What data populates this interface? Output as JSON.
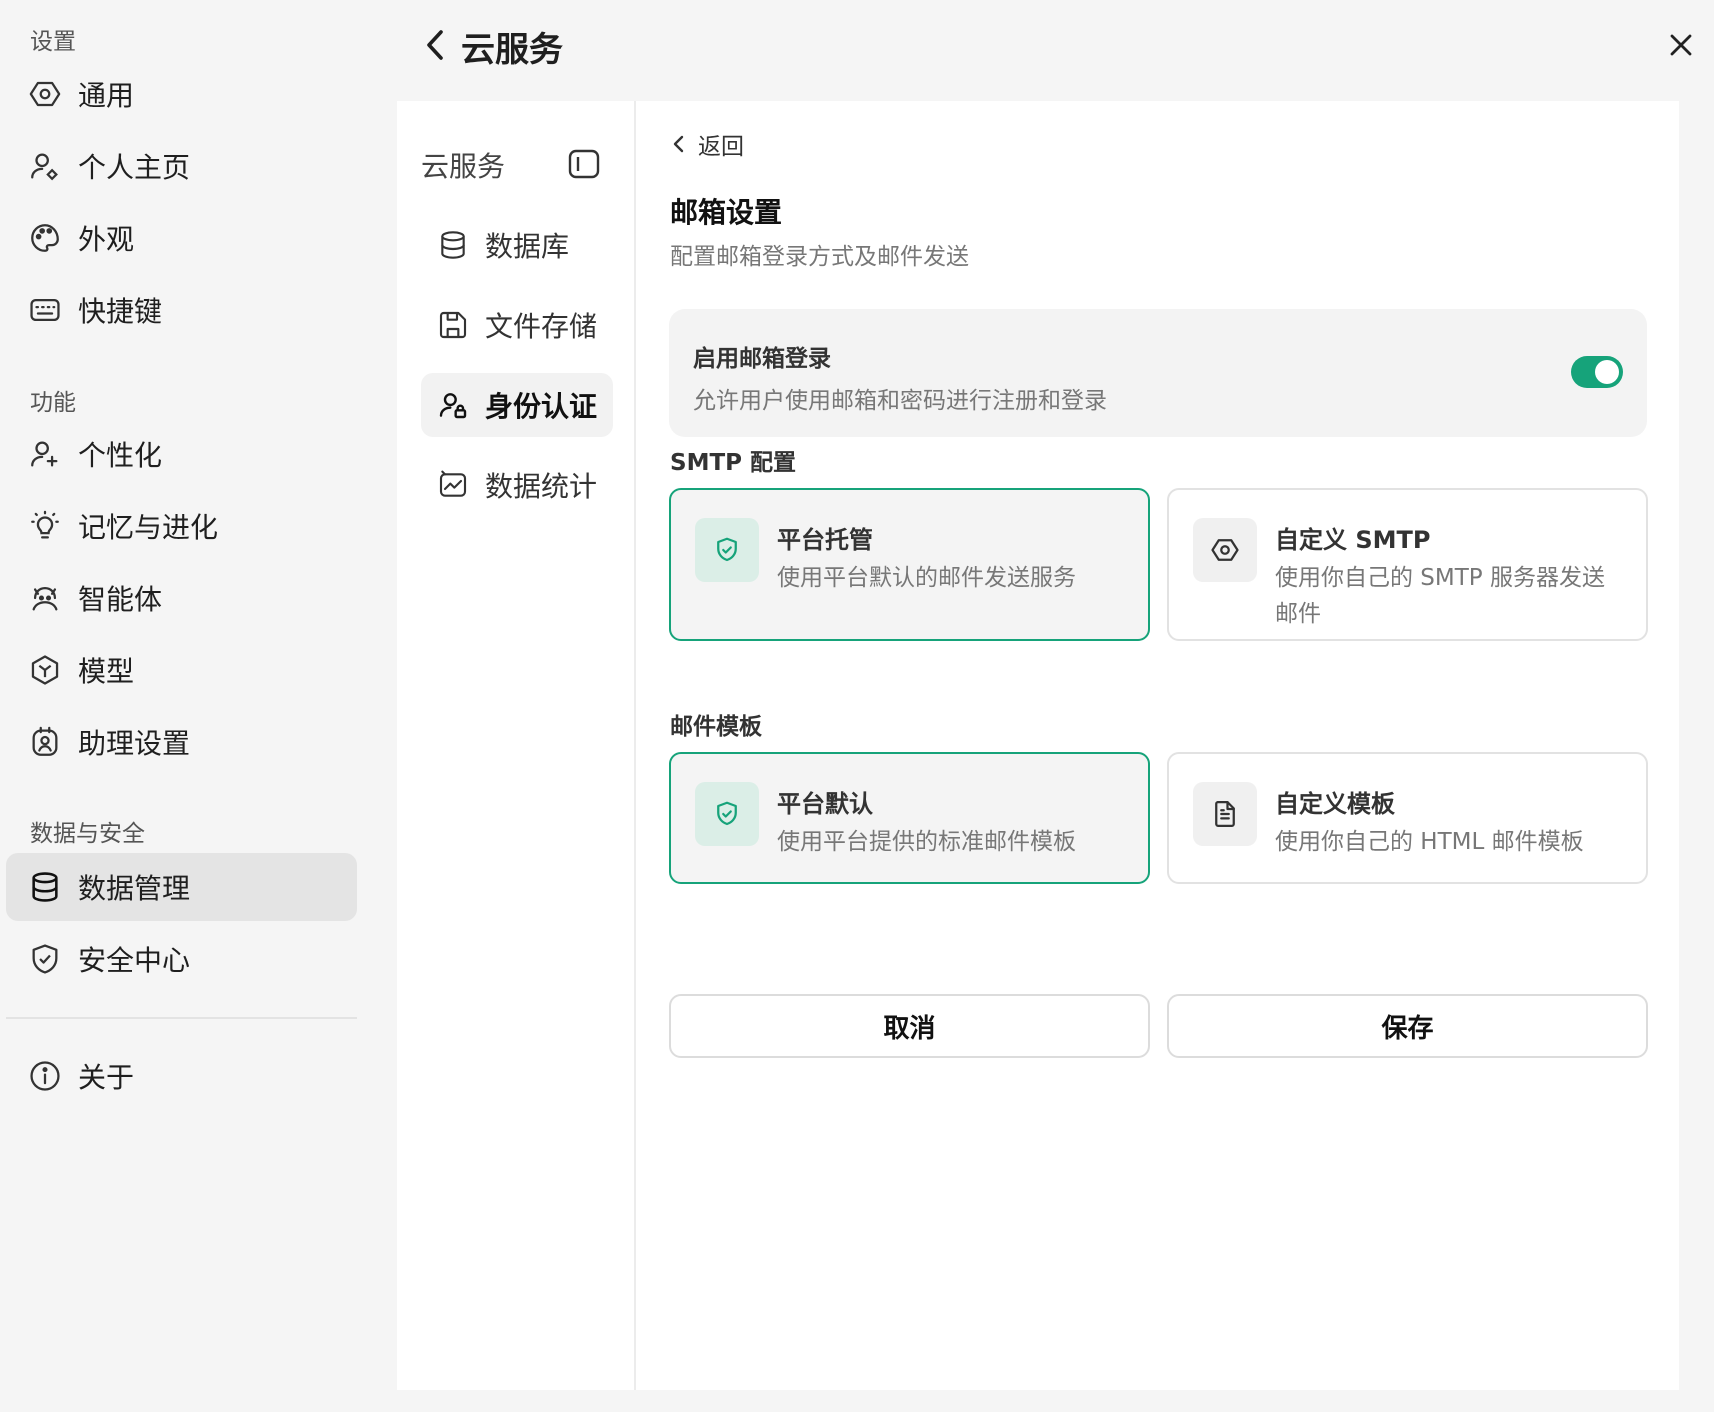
{
  "sidebar": {
    "sections": [
      {
        "title": "设置"
      },
      {
        "title": "功能"
      },
      {
        "title": "数据与安全"
      }
    ],
    "items": [
      {
        "label": "通用",
        "icon": "gear-icon"
      },
      {
        "label": "个人主页",
        "icon": "user-icon"
      },
      {
        "label": "外观",
        "icon": "palette-icon"
      },
      {
        "label": "快捷键",
        "icon": "keyboard-icon"
      },
      {
        "label": "个性化",
        "icon": "user-sparkle-icon"
      },
      {
        "label": "记忆与进化",
        "icon": "lightbulb-icon"
      },
      {
        "label": "智能体",
        "icon": "agent-icon"
      },
      {
        "label": "模型",
        "icon": "cube-icon"
      },
      {
        "label": "助理设置",
        "icon": "assistant-icon"
      },
      {
        "label": "数据管理",
        "icon": "database-icon",
        "active": true
      },
      {
        "label": "安全中心",
        "icon": "shield-icon"
      },
      {
        "label": "关于",
        "icon": "info-icon"
      }
    ]
  },
  "header": {
    "title": "云服务"
  },
  "subnav": {
    "title": "云服务",
    "items": [
      {
        "label": "数据库",
        "icon": "database-icon"
      },
      {
        "label": "文件存储",
        "icon": "save-icon"
      },
      {
        "label": "身份认证",
        "icon": "user-lock-icon",
        "active": true
      },
      {
        "label": "数据统计",
        "icon": "chart-icon"
      }
    ]
  },
  "main": {
    "back_label": "返回",
    "title": "邮箱设置",
    "description": "配置邮箱登录方式及邮件发送",
    "toggle": {
      "title": "启用邮箱登录",
      "description": "允许用户使用邮箱和密码进行注册和登录",
      "enabled": true
    },
    "smtp": {
      "label": "SMTP 配置",
      "options": [
        {
          "title": "平台托管",
          "description": "使用平台默认的邮件发送服务",
          "selected": true,
          "icon": "shield-check-icon"
        },
        {
          "title": "自定义 SMTP",
          "description": "使用你自己的 SMTP 服务器发送邮件",
          "selected": false,
          "icon": "gear-icon"
        }
      ]
    },
    "template": {
      "label": "邮件模板",
      "options": [
        {
          "title": "平台默认",
          "description": "使用平台提供的标准邮件模板",
          "selected": true,
          "icon": "shield-check-icon"
        },
        {
          "title": "自定义模板",
          "description": "使用你自己的 HTML 邮件模板",
          "selected": false,
          "icon": "document-icon"
        }
      ]
    },
    "cancel_label": "取消",
    "save_label": "保存"
  },
  "colors": {
    "accent": "#16a37a",
    "background": "#f5f5f5",
    "panel": "#ffffff"
  }
}
